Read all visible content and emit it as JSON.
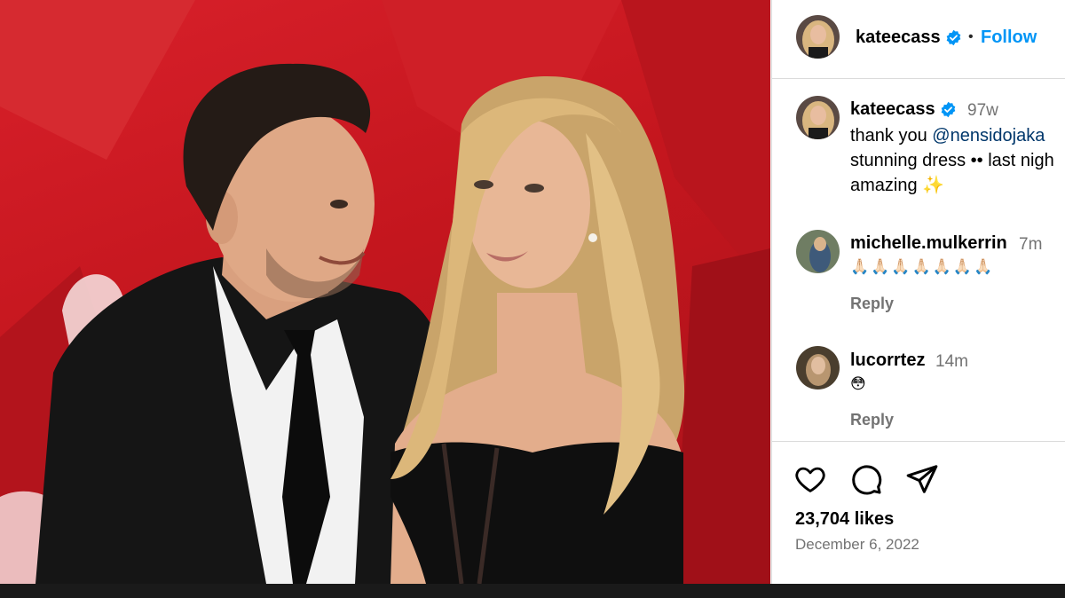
{
  "post": {
    "author": "kateecass",
    "follow_label": "Follow",
    "separator": "•",
    "caption": {
      "time": "97w",
      "text_before": "thank you ",
      "mention": "@nensidojaka",
      "line2": "stunning dress •• last nigh",
      "line3": "amazing ✨"
    },
    "comments": [
      {
        "user": "michelle.mulkerrin",
        "time": "7m",
        "text": "🙏🏻🙏🏻🙏🏻🙏🏻🙏🏻🙏🏻🙏🏻",
        "reply": "Reply"
      },
      {
        "user": "lucorrtez",
        "time": "14m",
        "text": "😳",
        "reply": "Reply"
      }
    ],
    "likes": "23,704 likes",
    "date": "December 6, 2022"
  },
  "icons": [
    "verified-badge-icon",
    "heart-icon",
    "comment-icon",
    "share-icon"
  ],
  "colors": {
    "link": "#0095f6",
    "mention": "#00376b",
    "secondary": "#737373",
    "verified": "#0095f6",
    "photo_bg": "#c4161e"
  }
}
